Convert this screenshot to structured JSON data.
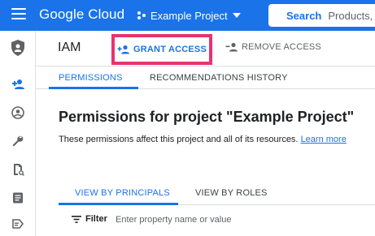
{
  "topbar": {
    "brand": "Google Cloud",
    "project_name": "Example Project",
    "search_label": "Search",
    "search_placeholder": "Products, resources, docs (/)",
    "color": "#1a73e8"
  },
  "rail": {
    "items": [
      {
        "icon": "add-person-icon",
        "active": true
      },
      {
        "icon": "account-circle-icon",
        "active": false
      },
      {
        "icon": "wrench-icon",
        "active": false
      },
      {
        "icon": "policy-doc-icon",
        "active": false
      },
      {
        "icon": "document-icon",
        "active": false
      },
      {
        "icon": "label-icon",
        "active": false
      }
    ]
  },
  "header": {
    "title": "IAM",
    "grant_access": "GRANT ACCESS",
    "remove_access": "REMOVE ACCESS"
  },
  "tabs": {
    "permissions": "PERMISSIONS",
    "recommendations_history": "RECOMMENDATIONS HISTORY"
  },
  "content": {
    "title": "Permissions for project \"Example Project\"",
    "description": "These permissions affect this project and all of its resources.",
    "learn_more": "Learn more"
  },
  "view_tabs": {
    "principals": "VIEW BY PRINCIPALS",
    "roles": "VIEW BY ROLES"
  },
  "filter": {
    "label": "Filter",
    "placeholder": "Enter property name or value"
  },
  "colors": {
    "accent": "#1a73e8",
    "highlight_border": "#e8336d"
  }
}
